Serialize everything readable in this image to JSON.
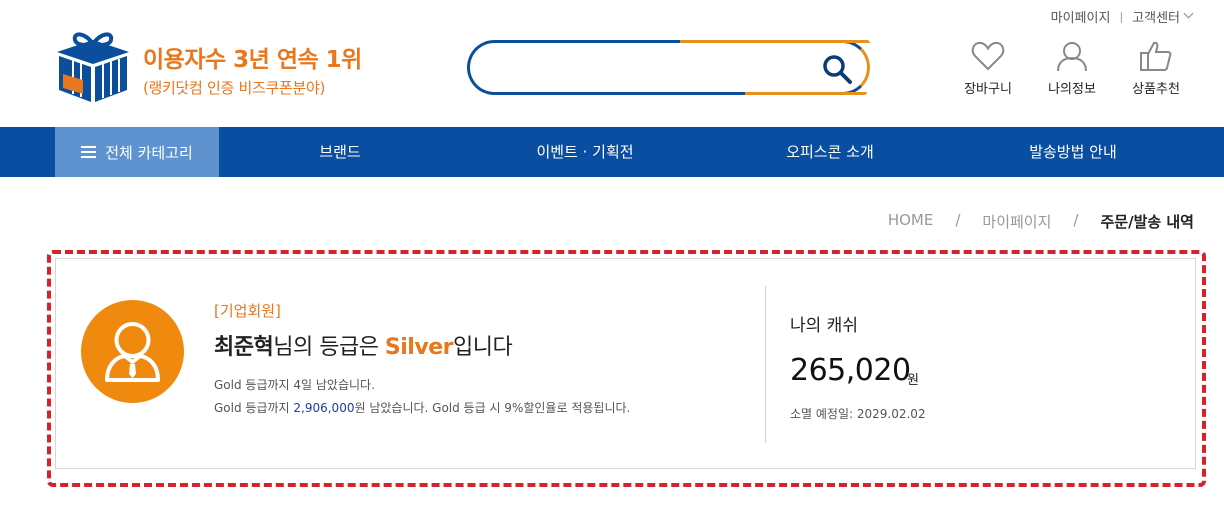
{
  "util": {
    "mypage": "마이페이지",
    "divider": "|",
    "support": "고객센터"
  },
  "logo": {
    "line1": "이용자수 3년 연속 1위",
    "line2": "(랭키닷컴 인증 비즈쿠폰분야)"
  },
  "search": {
    "value": "",
    "placeholder": ""
  },
  "header_icons": [
    {
      "label": "장바구니",
      "icon": "heart-icon"
    },
    {
      "label": "나의정보",
      "icon": "user-icon"
    },
    {
      "label": "상품추천",
      "icon": "thumbs-up-icon"
    }
  ],
  "nav": {
    "all_categories": "전체 카테고리",
    "items": [
      "브랜드",
      "이벤트 · 기획전",
      "오피스콘 소개",
      "발송방법 안내"
    ]
  },
  "breadcrumb": {
    "home": "HOME",
    "sep": "/",
    "level2": "마이페이지",
    "current": "주문/발송 내역"
  },
  "member": {
    "type": "[기업회원]",
    "name": "최준혁",
    "grade_prefix": "님의 등급은 ",
    "grade": "Silver",
    "grade_suffix": "입니다",
    "note1": "Gold 등급까지 4일 남았습니다.",
    "note2_prefix": "Gold 등급까지 ",
    "note2_amount": "2,906,000",
    "note2_suffix": "원 남았습니다. Gold 등급 시 9%할인율로 적용됩니다."
  },
  "cash": {
    "label": "나의 캐쉬",
    "value": "265,020",
    "unit": "원",
    "expire": "소멸 예정일: 2029.02.02"
  },
  "colors": {
    "brand_orange": "#e8771d",
    "nav_blue": "#0a4ea2",
    "nav_active": "#5f93cf",
    "frame_red": "#d62228"
  }
}
